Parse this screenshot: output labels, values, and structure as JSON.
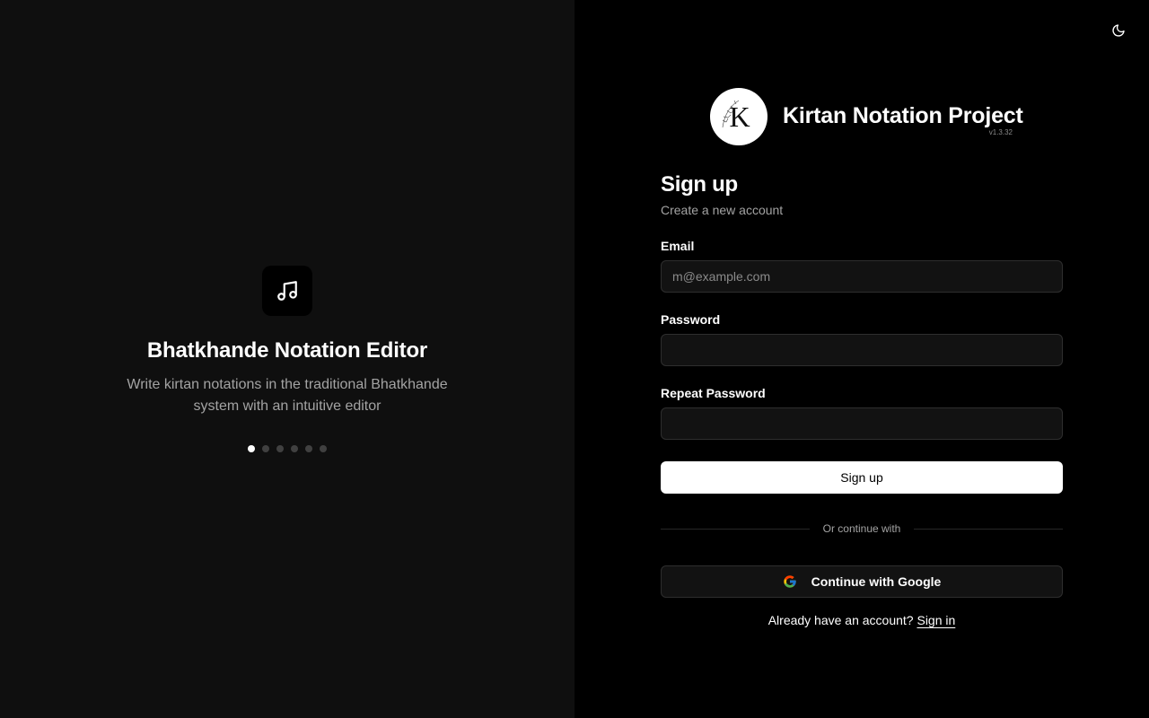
{
  "carousel": {
    "icon": "music-note-icon",
    "title": "Bhatkhande Notation Editor",
    "description": "Write kirtan notations in the traditional Bhatkhande system with an intuitive editor",
    "slide_count": 6,
    "active_slide": 1
  },
  "header": {
    "theme_toggle_icon": "moon-icon"
  },
  "brand": {
    "logo_letter": "K",
    "name": "Kirtan Notation Project",
    "version": "v1.3.32"
  },
  "form": {
    "title": "Sign up",
    "subtitle": "Create a new account",
    "email_label": "Email",
    "email_placeholder": "m@example.com",
    "email_value": "",
    "password_label": "Password",
    "password_value": "",
    "repeat_password_label": "Repeat Password",
    "repeat_password_value": "",
    "submit_label": "Sign up",
    "divider_text": "Or continue with",
    "google_label": "Continue with Google",
    "signin_prompt": "Already have an account?",
    "signin_link": "Sign in"
  },
  "colors": {
    "left_panel_bg": "#0f0f0f",
    "right_panel_bg": "#000000",
    "primary_button_bg": "#ffffff",
    "input_bg": "#121212",
    "muted_text": "#a3a3a3"
  }
}
